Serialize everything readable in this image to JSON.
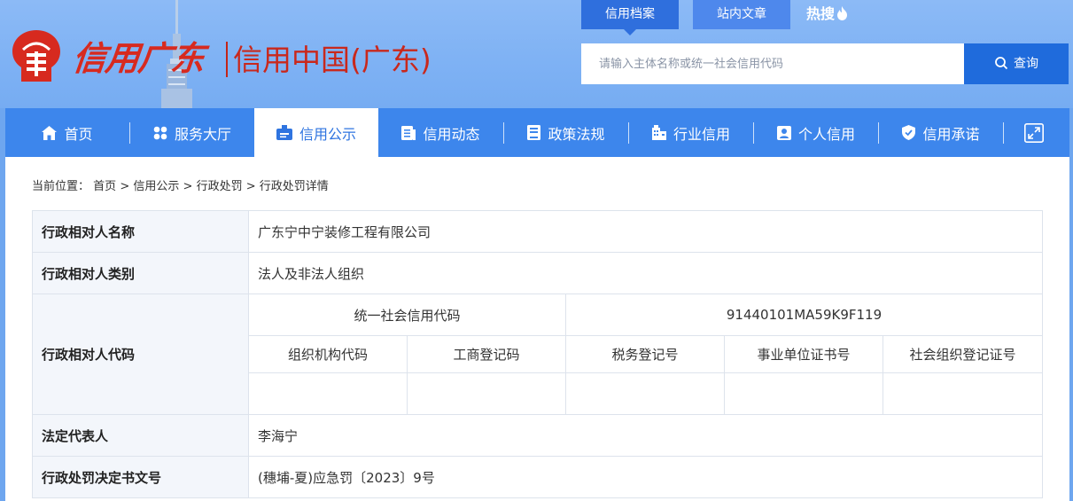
{
  "logo": {
    "script_text": "信用广东",
    "cn_text": "信用中国(广东)"
  },
  "top_tabs": [
    "信用档案",
    "站内文章"
  ],
  "hot_label": "热搜",
  "search": {
    "placeholder": "请输入主体名称或统一社会信用代码",
    "button_label": "查询"
  },
  "nav": {
    "items": [
      {
        "label": "首页",
        "icon": "home-icon"
      },
      {
        "label": "服务大厅",
        "icon": "grid-icon"
      },
      {
        "label": "信用公示",
        "icon": "badge-icon",
        "active": true
      },
      {
        "label": "信用动态",
        "icon": "news-icon"
      },
      {
        "label": "政策法规",
        "icon": "book-icon"
      },
      {
        "label": "行业信用",
        "icon": "building-icon"
      },
      {
        "label": "个人信用",
        "icon": "person-card-icon"
      },
      {
        "label": "信用承诺",
        "icon": "shield-check-icon"
      }
    ],
    "expand_icon": "expand-icon"
  },
  "breadcrumb": {
    "prefix": "当前位置：",
    "items": [
      "首页",
      "信用公示",
      "行政处罚",
      "行政处罚详情"
    ],
    "separator": ">"
  },
  "detail": {
    "rows": {
      "name": {
        "label": "行政相对人名称",
        "value": "广东宁中宁装修工程有限公司"
      },
      "category": {
        "label": "行政相对人类别",
        "value": "法人及非法人组织"
      },
      "code": {
        "label": "行政相对人代码",
        "uscc_label": "统一社会信用代码",
        "uscc_value": "91440101MA59K9F119",
        "sub_headers": [
          "组织机构代码",
          "工商登记码",
          "税务登记号",
          "事业单位证书号",
          "社会组织登记证号"
        ],
        "sub_values": [
          "",
          "",
          "",
          "",
          ""
        ]
      },
      "legal_rep": {
        "label": "法定代表人",
        "value": "李海宁"
      },
      "doc_no": {
        "label": "行政处罚决定书文号",
        "value": "(穗埔-夏)应急罚〔2023〕9号"
      }
    }
  },
  "colors": {
    "nav_bg": "#3d86ec",
    "active_text": "#2f74e0",
    "brand_red": "#d72a1f",
    "search_btn": "#1f6bdc"
  }
}
